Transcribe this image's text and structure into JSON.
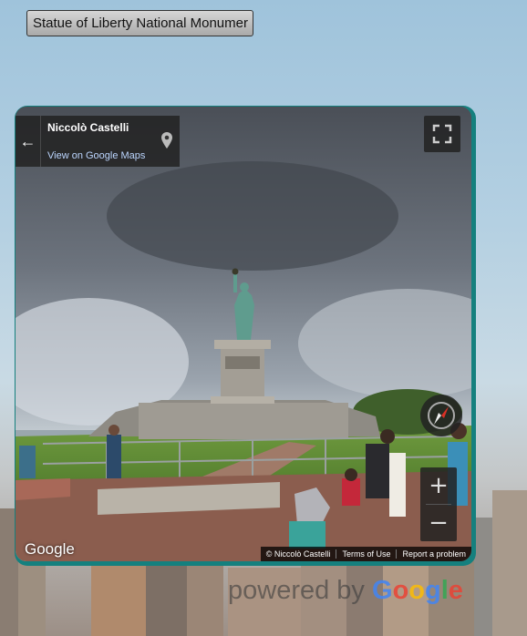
{
  "title_button": {
    "label": "Statue of Liberty National Monumer"
  },
  "streetview": {
    "author": "Niccolò Castelli",
    "view_link": "View on Google Maps",
    "google_logo": "Google",
    "footer": {
      "copyright": "© Niccolò Castelli",
      "terms": "Terms of Use",
      "report": "Report a problem"
    },
    "zoom_in": "+",
    "zoom_out": "−"
  },
  "powered_by": {
    "prefix": "powered by",
    "google_letters": [
      "G",
      "o",
      "o",
      "g",
      "l",
      "e"
    ],
    "google_colors": [
      "#4285F4",
      "#EA4335",
      "#FBBC05",
      "#4285F4",
      "#34A853",
      "#EA4335"
    ]
  },
  "icons": [
    "back-arrow-icon",
    "map-pin-icon",
    "fullscreen-icon",
    "compass-icon"
  ]
}
